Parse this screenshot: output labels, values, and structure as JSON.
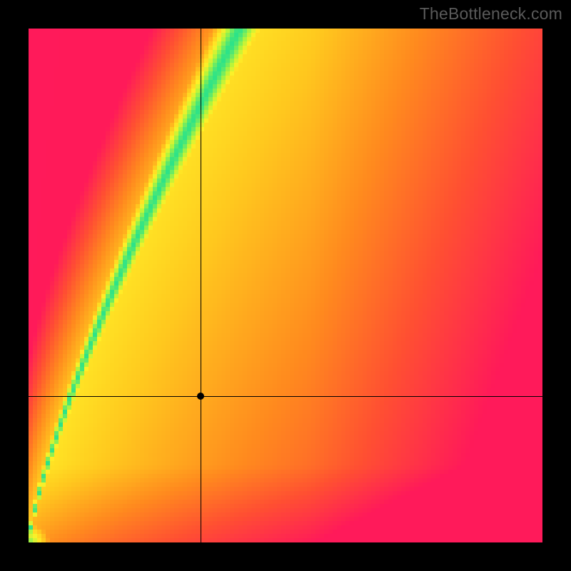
{
  "watermark": "TheBottleneck.com",
  "chart_data": {
    "type": "heatmap",
    "title": "",
    "xlabel": "",
    "ylabel": "",
    "xlim": [
      0,
      1
    ],
    "ylim": [
      0,
      1
    ],
    "grid": false,
    "legend": false,
    "optimal_curve_description": "Diagonal ridge from lower-left to upper-center-right; green marks low bottleneck along ridge, red marks high bottleneck",
    "marker": {
      "x": 0.335,
      "y": 0.285
    },
    "crosshair": {
      "x": 0.335,
      "y": 0.285
    },
    "colormap": [
      "#ff1a5a",
      "#ff6a2a",
      "#ffa020",
      "#ffd020",
      "#fff020",
      "#b0ff40",
      "#20e090"
    ],
    "resolution_hint": "pixelated ~120x120"
  }
}
